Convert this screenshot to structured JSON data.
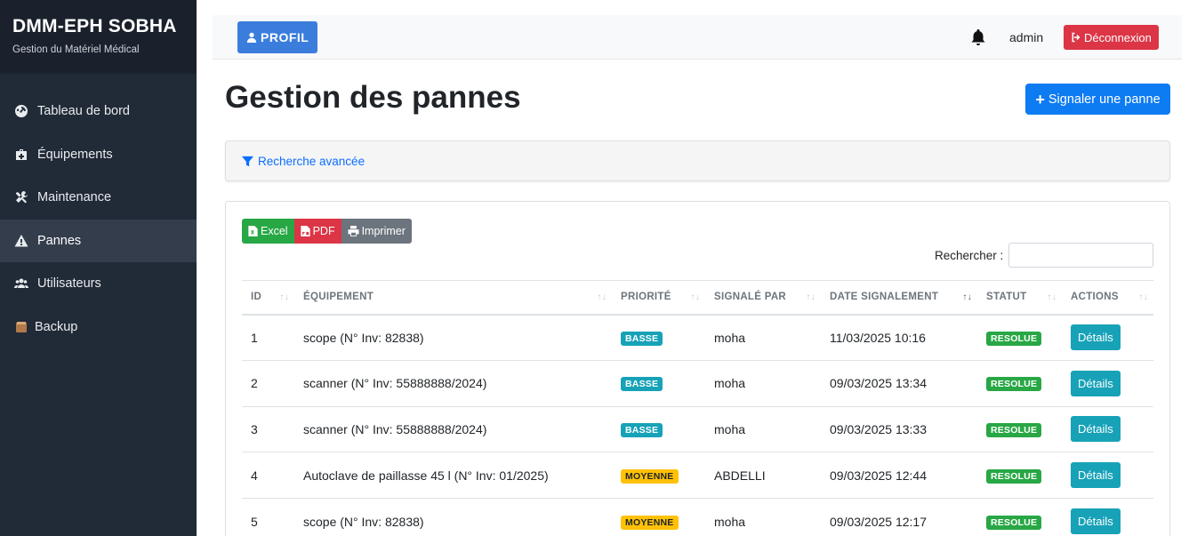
{
  "sidebar": {
    "title": "DMM-EPH SOBHA",
    "subtitle": "Gestion du Matériel Médical",
    "items": [
      {
        "label": "Tableau de bord",
        "icon": "dashboard-icon"
      },
      {
        "label": "Équipements",
        "icon": "medkit-icon"
      },
      {
        "label": "Maintenance",
        "icon": "tools-icon"
      },
      {
        "label": "Pannes",
        "icon": "warning-icon",
        "active": true
      },
      {
        "label": "Utilisateurs",
        "icon": "users-icon"
      },
      {
        "label": "Backup",
        "icon": "database-icon"
      }
    ]
  },
  "topbar": {
    "profil_label": "PROFIL",
    "user": "admin",
    "logout_label": "Déconnexion"
  },
  "main": {
    "title": "Gestion des pannes",
    "report_button": "Signaler une panne",
    "advanced_search": "Recherche avancée",
    "export": {
      "excel": "Excel",
      "pdf": "PDF",
      "print": "Imprimer"
    },
    "search_label": "Rechercher :",
    "columns": [
      "ID",
      "ÉQUIPEMENT",
      "PRIORITÉ",
      "SIGNALÉ PAR",
      "DATE SIGNALEMENT",
      "STATUT",
      "ACTIONS"
    ],
    "rows": [
      {
        "id": "1",
        "equipement": "scope (N° Inv: 82838)",
        "priorite": "BASSE",
        "signale_par": "moha",
        "date": "11/03/2025 10:16",
        "statut": "RESOLUE",
        "action": "Détails"
      },
      {
        "id": "2",
        "equipement": "scanner (N° Inv: 55888888/2024)",
        "priorite": "BASSE",
        "signale_par": "moha",
        "date": "09/03/2025 13:34",
        "statut": "RESOLUE",
        "action": "Détails"
      },
      {
        "id": "3",
        "equipement": "scanner (N° Inv: 55888888/2024)",
        "priorite": "BASSE",
        "signale_par": "moha",
        "date": "09/03/2025 13:33",
        "statut": "RESOLUE",
        "action": "Détails"
      },
      {
        "id": "4",
        "equipement": "Autoclave de paillasse 45 l (N° Inv: 01/2025)",
        "priorite": "MOYENNE",
        "signale_par": "ABDELLI",
        "date": "09/03/2025 12:44",
        "statut": "RESOLUE",
        "action": "Détails"
      },
      {
        "id": "5",
        "equipement": "scope (N° Inv: 82838)",
        "priorite": "MOYENNE",
        "signale_par": "moha",
        "date": "09/03/2025 12:17",
        "statut": "RESOLUE",
        "action": "Détails"
      }
    ]
  },
  "colors": {
    "sidebar_bg": "#212a37",
    "primary": "#0d7bf2",
    "danger": "#dc3545",
    "success": "#28a745",
    "info": "#17a2b8",
    "warning": "#ffc107"
  }
}
